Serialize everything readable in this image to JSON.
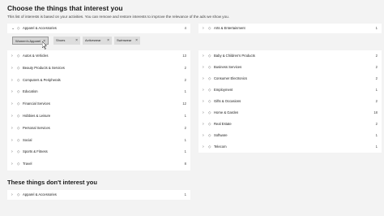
{
  "title": "Choose the things that interest you",
  "subtitle": "This list of interests is based on your activities. You can remove and restore interests to improve the relevance of the ads we show you.",
  "expanded": {
    "label": "Apparel & Accessories",
    "count": "4"
  },
  "chips": [
    "Women's Apparel",
    "Shoes",
    "Activewear",
    "Swimwear"
  ],
  "left_items": [
    {
      "label": "Autos & Vehicles",
      "count": "13"
    },
    {
      "label": "Beauty Products & Services",
      "count": "2"
    },
    {
      "label": "Computers & Peripherals",
      "count": "2"
    },
    {
      "label": "Education",
      "count": "1"
    },
    {
      "label": "Financial Services",
      "count": "12"
    },
    {
      "label": "Hobbies & Leisure",
      "count": "1"
    },
    {
      "label": "Personal Services",
      "count": "2"
    },
    {
      "label": "Social",
      "count": "1"
    },
    {
      "label": "Sports & Fitness",
      "count": "1"
    },
    {
      "label": "Travel",
      "count": "8"
    }
  ],
  "right_items": [
    {
      "label": "Arts & Entertainment",
      "count": "1"
    },
    {
      "label": "Baby & Children's Products",
      "count": "2"
    },
    {
      "label": "Business Services",
      "count": "2"
    },
    {
      "label": "Consumer Electronics",
      "count": "2"
    },
    {
      "label": "Employment",
      "count": "1"
    },
    {
      "label": "Gifts & Occasions",
      "count": "2"
    },
    {
      "label": "Home & Garden",
      "count": "18"
    },
    {
      "label": "Real Estate",
      "count": "2"
    },
    {
      "label": "Software",
      "count": "1"
    },
    {
      "label": "Telecom",
      "count": "1"
    }
  ],
  "section2_title": "These things don't interest you",
  "removed": {
    "label": "Apparel & Accessories",
    "count": "1"
  }
}
